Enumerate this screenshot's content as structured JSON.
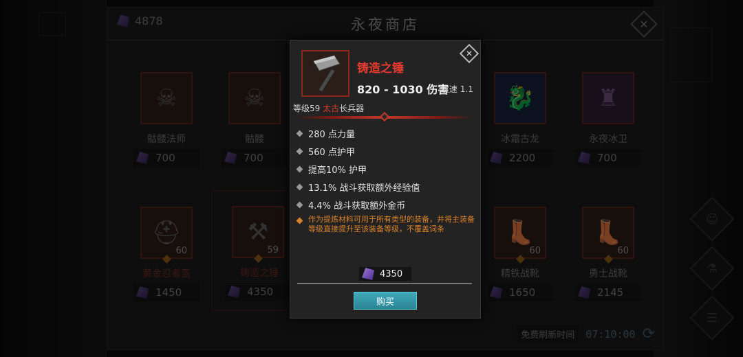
{
  "shop": {
    "title": "永夜商店",
    "currency_amount": "4878",
    "refresh_label": "免费刷新时间",
    "refresh_time": "07:10:00"
  },
  "items": [
    {
      "name": "骷髅法师",
      "price": "700",
      "level": "",
      "art": "☠"
    },
    {
      "name": "骷髅",
      "price": "700",
      "level": "",
      "art": "☠"
    },
    {
      "name": "冰霜古龙",
      "price": "2200",
      "level": "",
      "art": "🐉"
    },
    {
      "name": "永夜冰卫",
      "price": "700",
      "level": "",
      "art": "♜"
    },
    {
      "name": "黄金忍者盔",
      "price": "1450",
      "level": "60",
      "art": "⛑"
    },
    {
      "name": "铸造之锤",
      "price": "4350",
      "level": "59",
      "art": "⚒"
    },
    {
      "name": "精铁战靴",
      "price": "1650",
      "level": "60",
      "art": "👢"
    },
    {
      "name": "勇士战靴",
      "price": "2145",
      "level": "60",
      "art": "👢"
    }
  ],
  "popup": {
    "name": "铸造之锤",
    "damage": "820 - 1030 伤害",
    "speed_label": "攻速",
    "speed_value": "1.1",
    "type_prefix": "等级59 ",
    "type_quality": "太古",
    "type_suffix": "长兵器",
    "stats": [
      "280 点力量",
      "560 点护甲",
      "提高10% 护甲",
      "13.1% 战斗获取额外经验值",
      "4.4% 战斗获取额外金币"
    ],
    "note": "作为提炼材料可用于所有类型的装备，并将主装备等级直接提升至该装备等级，不覆盖词条",
    "price": "4350",
    "buy_label": "购买"
  },
  "colors": {
    "item_name_red": "#e63c2f",
    "note_orange": "#d9822a",
    "buy_button": "#2b8594"
  }
}
